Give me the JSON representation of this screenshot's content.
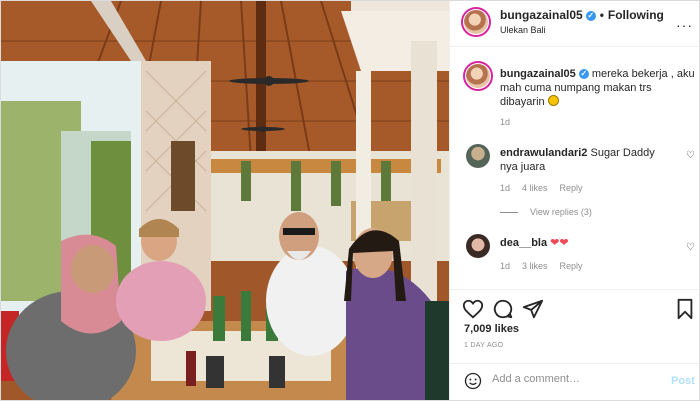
{
  "post": {
    "username": "bungazainal05",
    "verified": true,
    "follow_status": "Following",
    "location": "Ulekan Bali",
    "caption": "mereka bekerja , aku mah cuma numpang makan trs dibayarin",
    "caption_time": "1d"
  },
  "comments": [
    {
      "username": "endrawulandari2",
      "text": "Sugar Daddy nya juara",
      "time": "1d",
      "likes": "4 likes",
      "reply": "Reply",
      "view_replies": "View replies (3)"
    },
    {
      "username": "dea__bla",
      "text": "",
      "time": "1d",
      "likes": "3 likes",
      "reply": "Reply"
    }
  ],
  "stats": {
    "likes": "7,009 likes",
    "posted": "1 DAY AGO"
  },
  "add_comment": {
    "placeholder": "Add a comment…",
    "post_label": "Post"
  },
  "icons": {
    "like": "heart-icon",
    "comment": "comment-bubble-icon",
    "share": "paper-plane-icon",
    "save": "bookmark-icon",
    "emoji": "smiley-icon",
    "more": "more-options-icon"
  },
  "colors": {
    "link_blue": "#3897f0",
    "post_disabled": "#b2dffc",
    "muted": "#8e8e8e",
    "heart_red": "#ed4956"
  }
}
